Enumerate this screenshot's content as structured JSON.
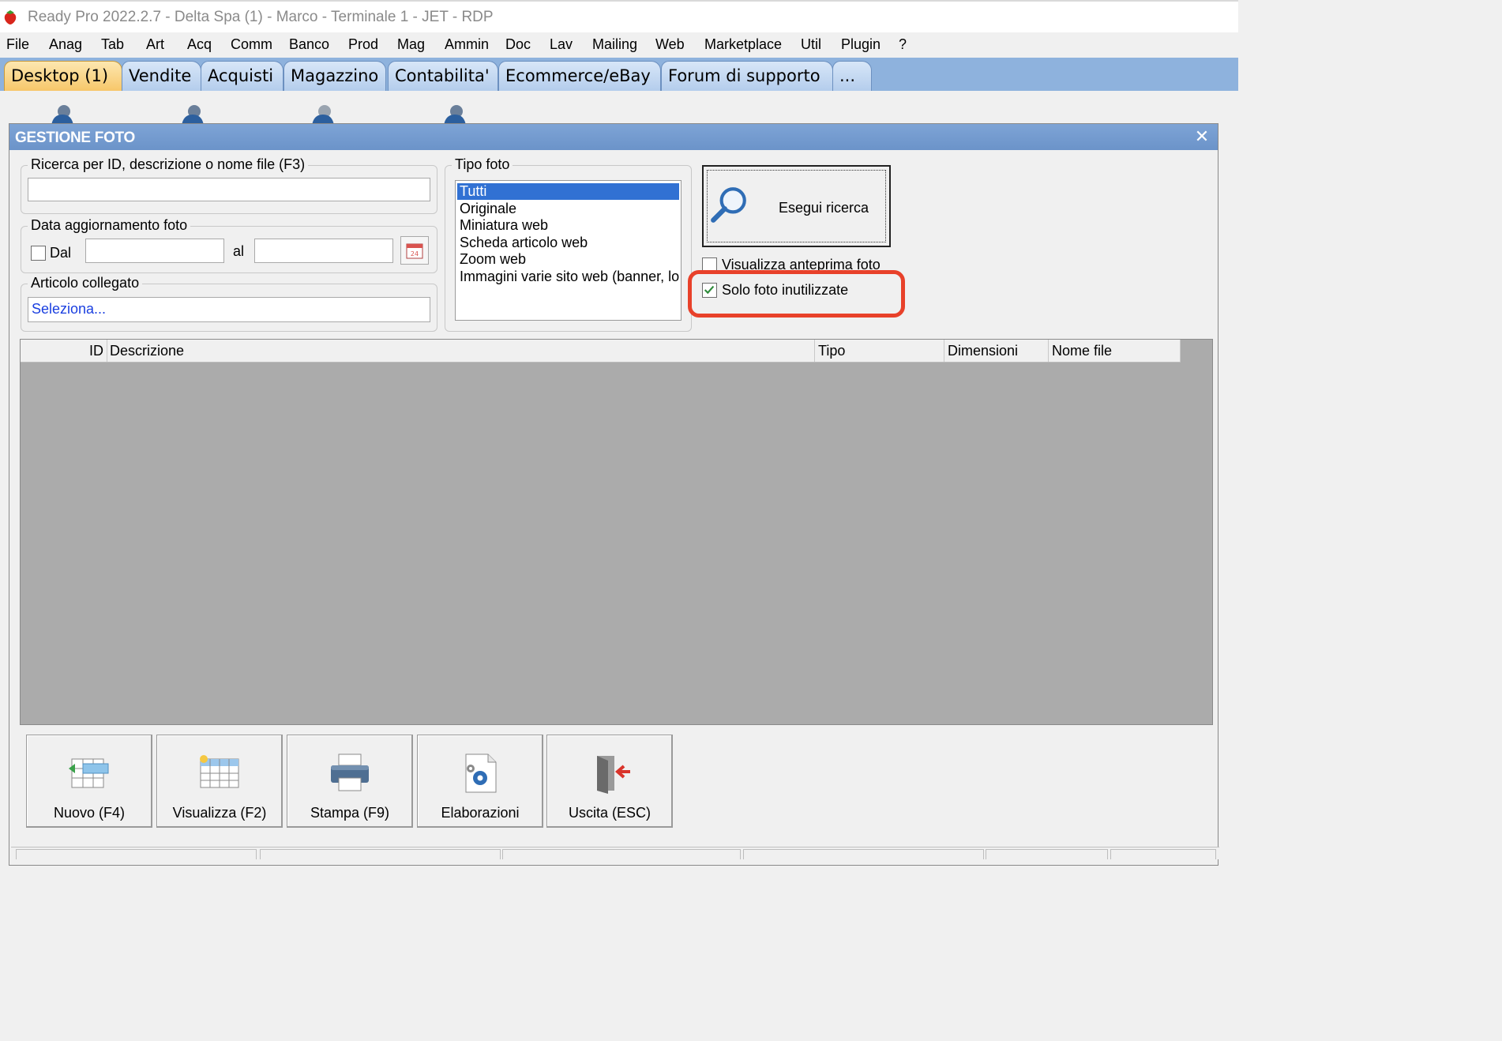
{
  "window": {
    "title": "Ready Pro 2022.2.7 - Delta Spa (1) - Marco - Terminale 1 - JET - RDP"
  },
  "menu": [
    "File",
    "Anag",
    "Tab",
    "Art",
    "Acq",
    "Comm",
    "Banco",
    "Prod",
    "Mag",
    "Ammin",
    "Doc",
    "Lav",
    "Mailing",
    "Web",
    "Marketplace",
    "Util",
    "Plugin",
    "?"
  ],
  "tabs": [
    "Desktop (1)",
    "Vendite",
    "Acquisti",
    "Magazzino",
    "Contabilita'",
    "Ecommerce/eBay",
    "Forum di supporto",
    "..."
  ],
  "dialog": {
    "title": "GESTIONE FOTO",
    "close": "✕",
    "search_group": {
      "label": "Ricerca per ID, descrizione o nome file (F3)",
      "value": ""
    },
    "date_group": {
      "label": "Data aggiornamento foto",
      "dal_label": "Dal",
      "al_label": "al",
      "dal_value": "",
      "al_value": "",
      "calendar_day": "24"
    },
    "articolo_group": {
      "label": "Articolo collegato",
      "value": "Seleziona..."
    },
    "tipo_group": {
      "label": "Tipo foto",
      "options": [
        "Tutti",
        "Originale",
        "Miniatura web",
        "Scheda articolo web",
        "Zoom web",
        "Immagini varie sito web (banner, loghi)"
      ],
      "selected": "Tutti"
    },
    "search_button": "Esegui ricerca",
    "anteprima_label": "Visualizza anteprima foto",
    "anteprima_checked": false,
    "solo_label": "Solo foto inutilizzate",
    "solo_checked": true,
    "grid": {
      "columns": [
        "ID",
        "Descrizione",
        "Tipo",
        "Dimensioni",
        "Nome file"
      ],
      "rows": []
    },
    "buttons": [
      "Nuovo (F4)",
      "Visualizza (F2)",
      "Stampa (F9)",
      "Elaborazioni",
      "Uscita (ESC)"
    ]
  },
  "colors": {
    "highlight": "#e8412a",
    "header": "#7ea4d6",
    "selection": "#3171d3",
    "active_tab": "#f7c76a"
  }
}
